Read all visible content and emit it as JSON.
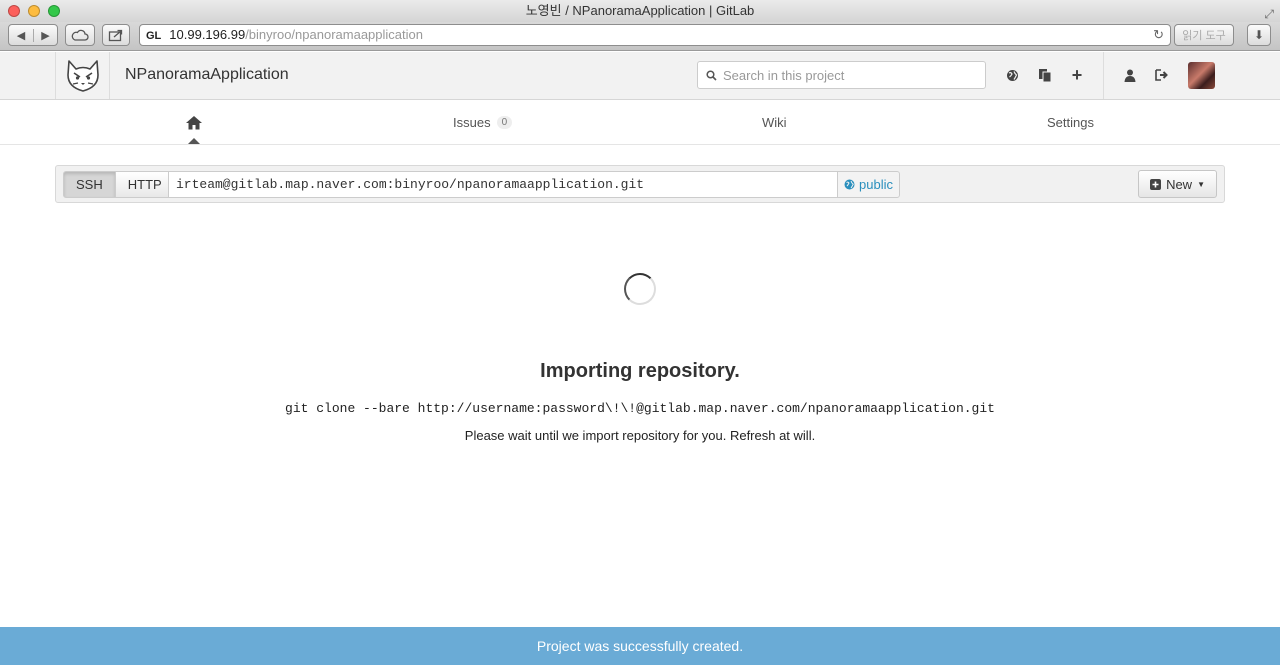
{
  "window": {
    "title": "노영빈 / NPanoramaApplication | GitLab"
  },
  "browser": {
    "favicon_text": "GL",
    "url_host": "10.99.196.99",
    "url_path": "/binyroo/npanoramaapplication",
    "reader_label": "읽기 도구"
  },
  "header": {
    "project_name": "NPanoramaApplication",
    "search_placeholder": "Search in this project"
  },
  "nav": {
    "issues_label": "Issues",
    "issues_count": "0",
    "wiki_label": "Wiki",
    "settings_label": "Settings"
  },
  "clone": {
    "ssh_label": "SSH",
    "http_label": "HTTP",
    "url": "irteam@gitlab.map.naver.com:binyroo/npanoramaapplication.git",
    "visibility": "public",
    "new_label": "New"
  },
  "import": {
    "title": "Importing repository.",
    "command": "git clone --bare http://username:password\\!\\!@gitlab.map.naver.com/npanoramaapplication.git",
    "note": "Please wait until we import repository for you. Refresh at will."
  },
  "flash": {
    "message": "Project was successfully created."
  },
  "colors": {
    "flash_bg": "#6aabd6",
    "link_accent": "#2a8fbd"
  }
}
